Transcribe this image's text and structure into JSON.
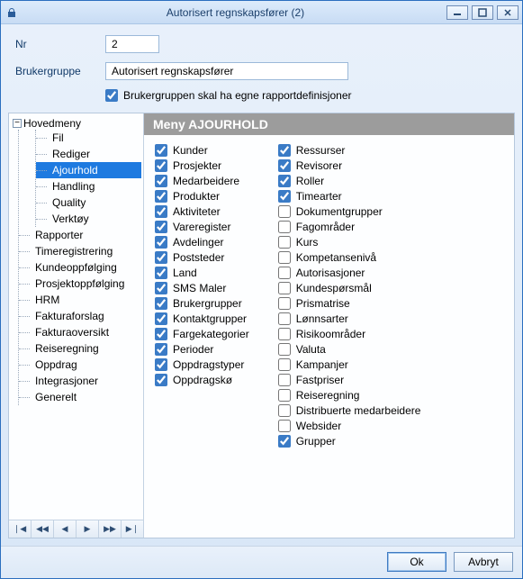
{
  "window": {
    "title": "Autorisert regnskapsfører (2)"
  },
  "form": {
    "nr_label": "Nr",
    "nr_value": "2",
    "group_label": "Brukergruppe",
    "group_value": "Autorisert regnskapsfører",
    "own_reports_label": "Brukergruppen skal ha egne rapportdefinisjoner",
    "own_reports_checked": true
  },
  "tree": {
    "root": "Hovedmeny",
    "items": [
      "Fil",
      "Rediger",
      "Ajourhold",
      "Handling",
      "Quality",
      "Verktøy"
    ],
    "selected": "Ajourhold",
    "siblings": [
      "Rapporter",
      "Timeregistrering",
      "Kundeoppfølging",
      "Prosjektoppfølging",
      "HRM",
      "Fakturaforslag",
      "Fakturaoversikt",
      "Reiseregning",
      "Oppdrag",
      "Integrasjoner",
      "Generelt"
    ]
  },
  "content": {
    "header": "Meny AJOURHOLD",
    "col1": [
      {
        "label": "Kunder",
        "checked": true
      },
      {
        "label": "Prosjekter",
        "checked": true
      },
      {
        "label": "Medarbeidere",
        "checked": true
      },
      {
        "label": "Produkter",
        "checked": true
      },
      {
        "label": "Aktiviteter",
        "checked": true
      },
      {
        "label": "Vareregister",
        "checked": true
      },
      {
        "label": "Avdelinger",
        "checked": true
      },
      {
        "label": "Poststeder",
        "checked": true
      },
      {
        "label": "Land",
        "checked": true
      },
      {
        "label": "SMS Maler",
        "checked": true
      },
      {
        "label": "Brukergrupper",
        "checked": true
      },
      {
        "label": "Kontaktgrupper",
        "checked": true
      },
      {
        "label": "Fargekategorier",
        "checked": true
      },
      {
        "label": "Perioder",
        "checked": true
      },
      {
        "label": "Oppdragstyper",
        "checked": true
      },
      {
        "label": "Oppdragskø",
        "checked": true
      }
    ],
    "col2": [
      {
        "label": "Ressurser",
        "checked": true
      },
      {
        "label": "Revisorer",
        "checked": true
      },
      {
        "label": "Roller",
        "checked": true
      },
      {
        "label": "Timearter",
        "checked": true
      },
      {
        "label": "Dokumentgrupper",
        "checked": false
      },
      {
        "label": "Fagområder",
        "checked": false
      },
      {
        "label": "Kurs",
        "checked": false
      },
      {
        "label": "Kompetansenivå",
        "checked": false
      },
      {
        "label": "Autorisasjoner",
        "checked": false
      },
      {
        "label": "Kundespørsmål",
        "checked": false
      },
      {
        "label": "Prismatrise",
        "checked": false
      },
      {
        "label": "Lønnsarter",
        "checked": false
      },
      {
        "label": "Risikoområder",
        "checked": false
      },
      {
        "label": "Valuta",
        "checked": false
      },
      {
        "label": "Kampanjer",
        "checked": false
      },
      {
        "label": "Fastpriser",
        "checked": false
      },
      {
        "label": "Reiseregning",
        "checked": false
      },
      {
        "label": "Distribuerte medarbeidere",
        "checked": false
      },
      {
        "label": "Websider",
        "checked": false
      },
      {
        "label": "Grupper",
        "checked": true
      }
    ]
  },
  "footer": {
    "ok": "Ok",
    "cancel": "Avbryt"
  },
  "nav": {
    "first": "❘◀",
    "prev_page": "◀◀",
    "prev": "◀",
    "next": "▶",
    "next_page": "▶▶",
    "last": "▶❘"
  }
}
